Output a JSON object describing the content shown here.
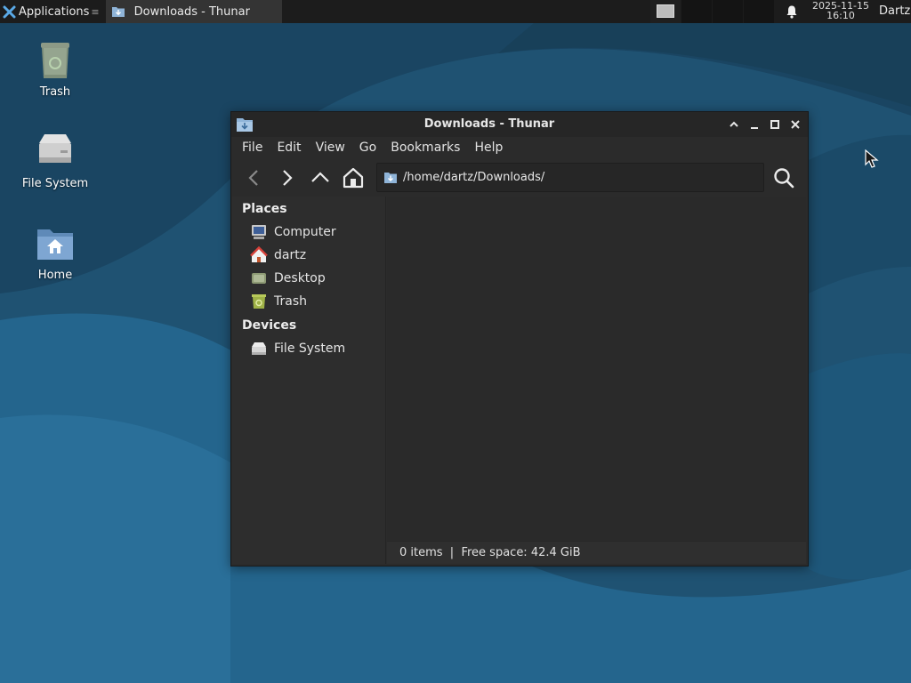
{
  "panel": {
    "applications_label": "Applications",
    "task_label": "Downloads - Thunar",
    "clock_date": "2025-11-15",
    "clock_time": "16:10",
    "user_label": "Dartz"
  },
  "desktop": {
    "icons": [
      {
        "label": "Trash",
        "icon": "trash-icon"
      },
      {
        "label": "File System",
        "icon": "drive-icon"
      },
      {
        "label": "Home",
        "icon": "home-folder-icon"
      }
    ]
  },
  "window": {
    "title": "Downloads - Thunar",
    "menu": [
      "File",
      "Edit",
      "View",
      "Go",
      "Bookmarks",
      "Help"
    ],
    "location_path": "/home/dartz/Downloads/",
    "sidebar": {
      "places_heading": "Places",
      "places": [
        {
          "label": "Computer",
          "icon": "computer-icon"
        },
        {
          "label": "dartz",
          "icon": "home-icon"
        },
        {
          "label": "Desktop",
          "icon": "desktop-icon"
        },
        {
          "label": "Trash",
          "icon": "trash-icon"
        }
      ],
      "devices_heading": "Devices",
      "devices": [
        {
          "label": "File System",
          "icon": "drive-icon"
        }
      ]
    },
    "status": "0 items  |  Free space: 42.4 GiB"
  },
  "colors": {
    "wallpaper_dark": "#1c4b6a",
    "wallpaper_light": "#2a6a92",
    "panel_bg": "#1c1c1c",
    "window_bg": "#2b2b2b"
  }
}
